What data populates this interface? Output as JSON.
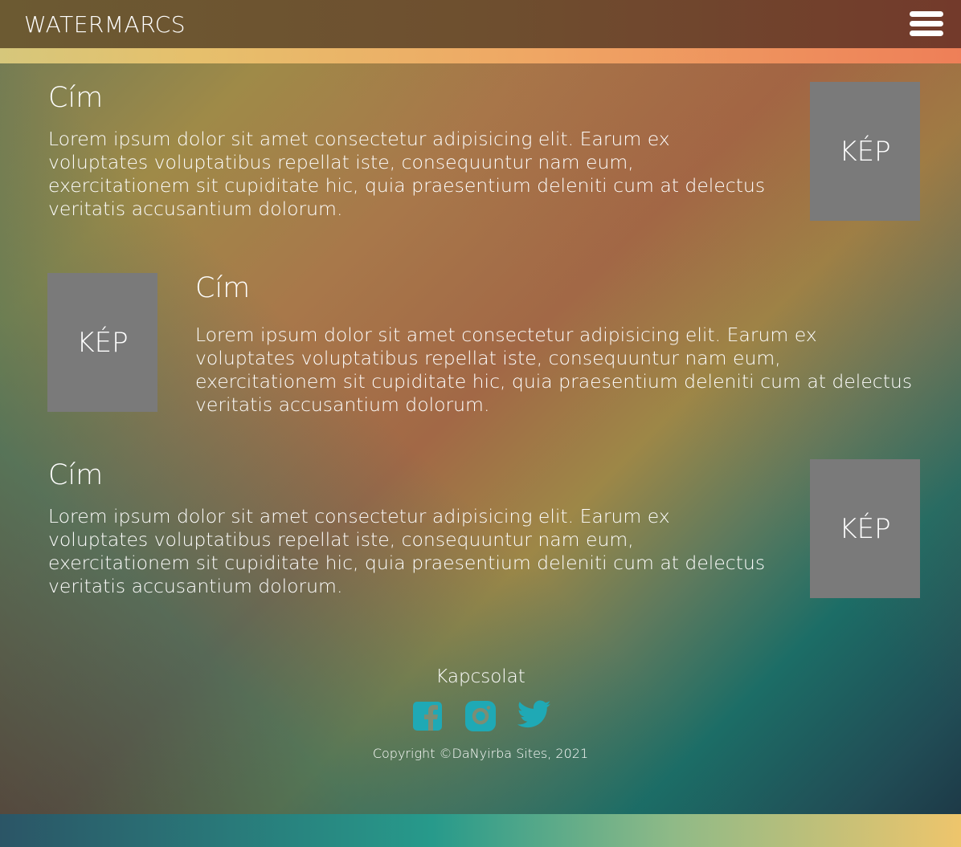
{
  "header": {
    "brand": "WATERMARCS",
    "menu_icon": "hamburger-menu-icon"
  },
  "sections": [
    {
      "title": "Cím",
      "text": "Lorem ipsum dolor sit amet consectetur adipisicing elit. Earum ex voluptates voluptatibus repellat iste, consequuntur nam eum, exercitationem sit cupiditate hic, quia praesentium deleniti cum at delectus veritatis accusantium dolorum.",
      "image_label": "KÉP"
    },
    {
      "title": "Cím",
      "text": "Lorem ipsum dolor sit amet consectetur adipisicing elit. Earum ex voluptates voluptatibus repellat iste, consequuntur nam eum, exercitationem sit cupiditate hic, quia praesentium deleniti cum at delectus veritatis accusantium dolorum.",
      "image_label": "KÉP"
    },
    {
      "title": "Cím",
      "text": "Lorem ipsum dolor sit amet consectetur adipisicing elit. Earum ex voluptates voluptatibus repellat iste, consequuntur nam eum, exercitationem sit cupiditate hic, quia praesentium deleniti cum at delectus veritatis accusantium dolorum.",
      "image_label": "KÉP"
    }
  ],
  "footer": {
    "title": "Kapcsolat",
    "social": [
      {
        "name": "facebook-icon",
        "color": "#1fa9b5"
      },
      {
        "name": "instagram-icon",
        "color": "#1fa9b5"
      },
      {
        "name": "twitter-icon",
        "color": "#1fa9b5"
      }
    ],
    "copyright": "Copyright ©DaNyirba Sites, 2021"
  }
}
